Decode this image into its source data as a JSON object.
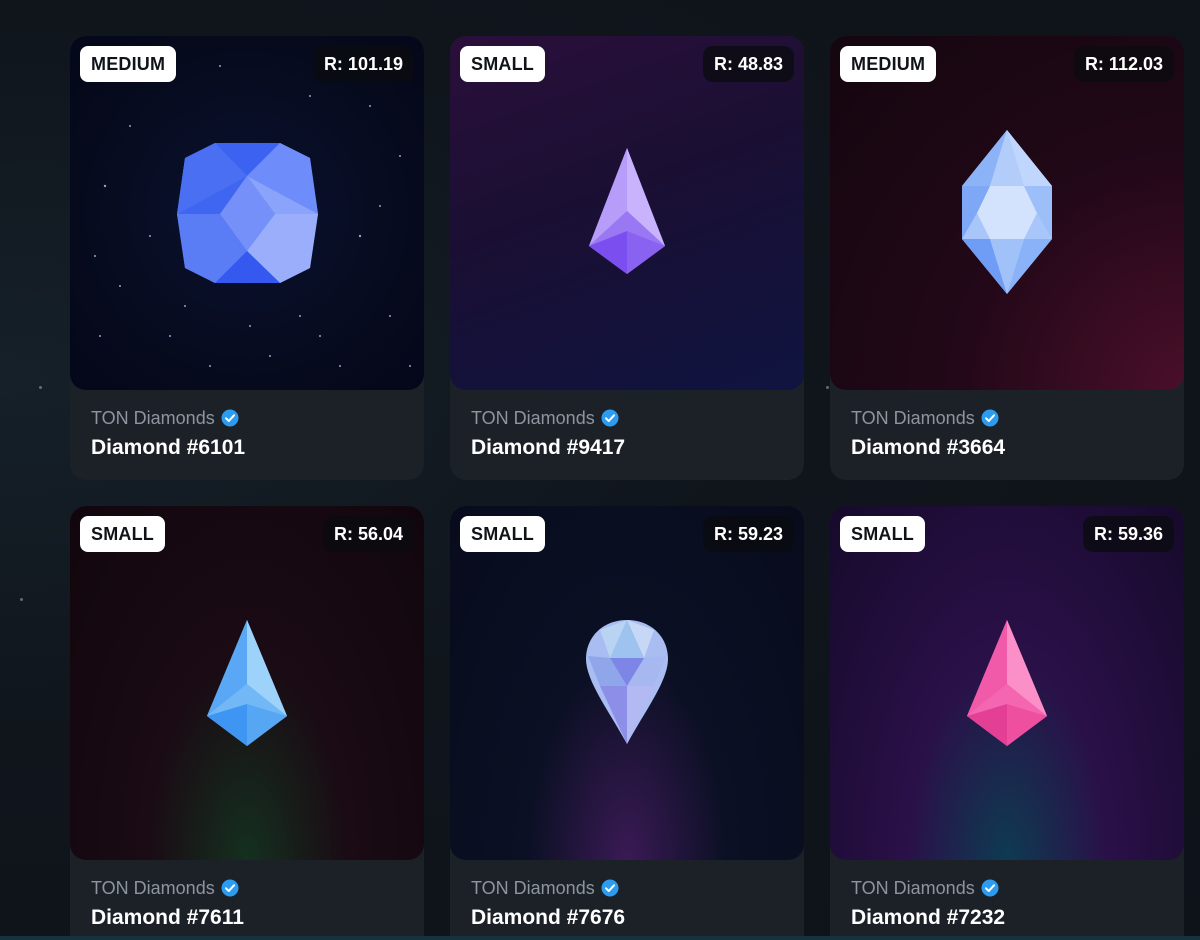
{
  "collection_name": "TON Diamonds",
  "verified_icon": "verified-check-icon",
  "cards": [
    {
      "size": "MEDIUM",
      "rarity": "R: 101.19",
      "name": "Diamond #6101",
      "gem_color": "#4b6df5",
      "background": "starry-night"
    },
    {
      "size": "SMALL",
      "rarity": "R: 48.83",
      "name": "Diamond #9417",
      "gem_color": "#9b6ff5",
      "background": "violet-navy"
    },
    {
      "size": "MEDIUM",
      "rarity": "R: 112.03",
      "name": "Diamond #3664",
      "gem_color": "#8fb8f7",
      "background": "dark-crimson"
    },
    {
      "size": "SMALL",
      "rarity": "R: 56.04",
      "name": "Diamond #7611",
      "gem_color": "#6fb6f7",
      "background": "maroon-green-glow"
    },
    {
      "size": "SMALL",
      "rarity": "R: 59.23",
      "name": "Diamond #7676",
      "gem_color": "#9fb5ef",
      "background": "navy-purple-glow"
    },
    {
      "size": "SMALL",
      "rarity": "R: 59.36",
      "name": "Diamond #7232",
      "gem_color": "#f25aa8",
      "background": "purple-teal-glow"
    }
  ]
}
